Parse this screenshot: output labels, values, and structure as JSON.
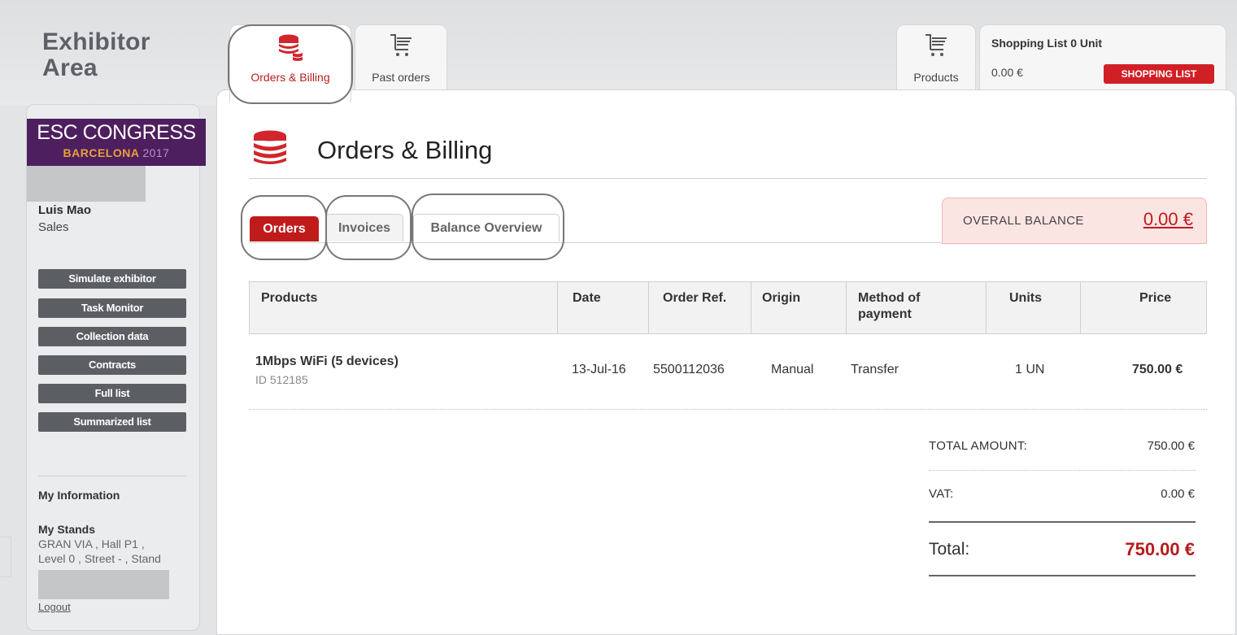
{
  "brand": {
    "line1": "Exhibitor",
    "line2": "Area"
  },
  "sidebar": {
    "logo": {
      "line1": "ESC CONGRESS",
      "line2_city": "BARCELONA",
      "line2_year": "2017"
    },
    "user": {
      "name": "Luis Mao",
      "role": "Sales"
    },
    "admin_buttons": [
      "Simulate exhibitor",
      "Task Monitor",
      "Collection data",
      "Contracts",
      "Full list",
      "Summarized list"
    ],
    "my_information": "My Information",
    "my_stands": {
      "title": "My Stands",
      "lines": [
        "GRAN VIA , Hall P1 ,",
        "Level 0 , Street - , Stand"
      ]
    },
    "logout": "Logout"
  },
  "top_tabs": {
    "orders_billing": "Orders & Billing",
    "past_orders": "Past orders",
    "products": "Products"
  },
  "shopping_list": {
    "title": "Shopping List 0 Unit",
    "amount": "0.00 €",
    "button": "SHOPPING LIST"
  },
  "page": {
    "title": "Orders & Billing",
    "subtabs": {
      "orders": "Orders",
      "invoices": "Invoices",
      "balance_overview": "Balance Overview"
    },
    "overall_balance": {
      "label": "OVERALL BALANCE",
      "value": "0.00 €"
    }
  },
  "table": {
    "headers": {
      "products": "Products",
      "date": "Date",
      "order_ref": "Order Ref.",
      "origin": "Origin",
      "method_line1": "Method of",
      "method_line2": "payment",
      "units": "Units",
      "price": "Price"
    },
    "rows": [
      {
        "product": "1Mbps WiFi (5 devices)",
        "product_id": "ID 512185",
        "date": "13-Jul-16",
        "order_ref": "5500112036",
        "origin": "Manual",
        "method": "Transfer",
        "units": "1 UN",
        "price": "750.00 €"
      }
    ]
  },
  "summary": {
    "total_amount_label": "TOTAL AMOUNT:",
    "total_amount": "750.00 €",
    "vat_label": "VAT:",
    "vat": "0.00 €",
    "total_label": "Total:",
    "total": "750.00 €"
  },
  "colors": {
    "accent_red": "#c01b1b",
    "sidebar_button": "#5b5e63",
    "logo_purple": "#4e1f5e"
  },
  "icons": {
    "orders_billing": "coin-stack-icon",
    "past_orders": "cart-icon",
    "products": "cart-icon",
    "page_title": "coin-stack-icon"
  }
}
